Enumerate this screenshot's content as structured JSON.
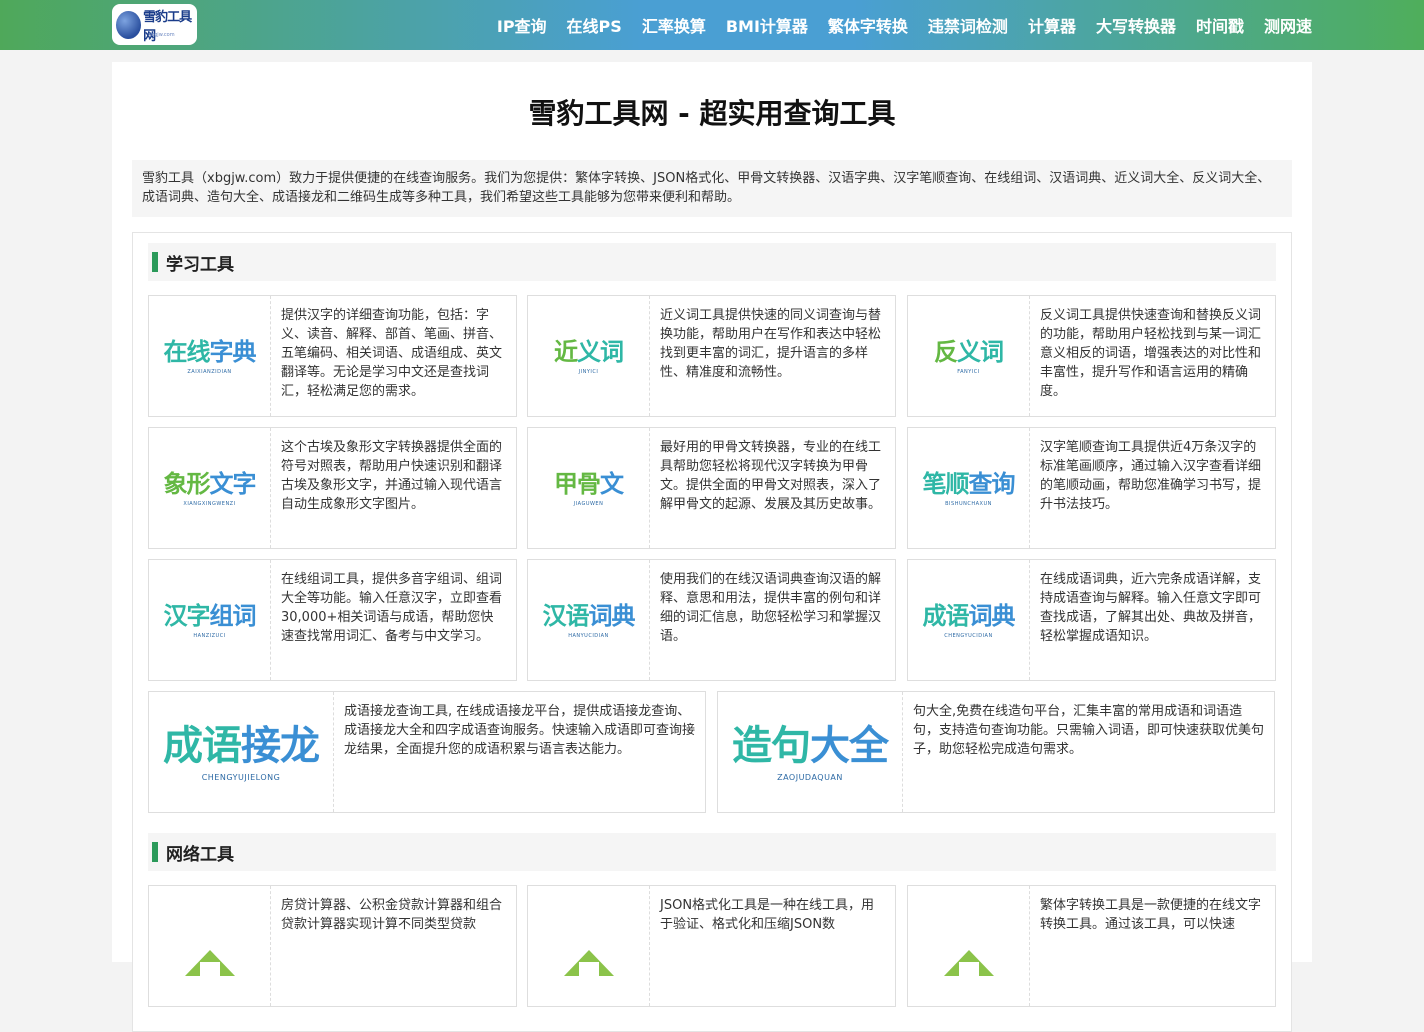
{
  "logo": {
    "text": "雪豹工具网",
    "sub": "xbgjw.com"
  },
  "nav": [
    "IP查询",
    "在线PS",
    "汇率换算",
    "BMI计算器",
    "繁体字转换",
    "违禁词检测",
    "计算器",
    "大写转换器",
    "时间戳",
    "测网速"
  ],
  "page_title": "雪豹工具网 - 超实用查询工具",
  "intro": "雪豹工具（xbgjw.com）致力于提供便捷的在线查询服务。我们为您提供：繁体字转换、JSON格式化、甲骨文转换器、汉语字典、汉字笔顺查询、在线组词、汉语词典、近义词大全、反义词大全、成语词典、造句大全、成语接龙和二维码生成等多种工具，我们希望这些工具能够为您带来便利和帮助。",
  "sections": {
    "study": {
      "title": "学习工具"
    },
    "network": {
      "title": "网络工具"
    }
  },
  "cards": [
    {
      "logo_a": "在线",
      "logo_b": "字典",
      "logo_sub": "ZAIXIANZIDIAN",
      "desc": "提供汉字的详细查询功能，包括：字义、读音、解释、部首、笔画、拼音、五笔编码、相关词语、成语组成、英文翻译等。无论是学习中文还是查找词汇，轻松满足您的需求。"
    },
    {
      "logo_a": "近",
      "logo_b": "义词",
      "logo_sub": "JINYICI",
      "desc": "近义词工具提供快速的同义词查询与替换功能，帮助用户在写作和表达中轻松找到更丰富的词汇，提升语言的多样性、精准度和流畅性。"
    },
    {
      "logo_a": "反",
      "logo_b": "义词",
      "logo_sub": "FANYICI",
      "desc": "反义词工具提供快速查询和替换反义词的功能，帮助用户轻松找到与某一词汇意义相反的词语，增强表达的对比性和丰富性，提升写作和语言运用的精确度。"
    },
    {
      "logo_a": "象形",
      "logo_b": "文字",
      "logo_sub": "XIANGXINGWENZI",
      "desc": "这个古埃及象形文字转换器提供全面的符号对照表，帮助用户快速识别和翻译古埃及象形文字，并通过输入现代语言自动生成象形文字图片。"
    },
    {
      "logo_a": "甲骨",
      "logo_b": "文",
      "logo_sub": "JIAGUWEN",
      "desc": "最好用的甲骨文转换器，专业的在线工具帮助您轻松将现代汉字转换为甲骨文。提供全面的甲骨文对照表，深入了解甲骨文的起源、发展及其历史故事。"
    },
    {
      "logo_a": "笔顺",
      "logo_b": "查询",
      "logo_sub": "BISHUNCHAXUN",
      "desc": "汉字笔顺查询工具提供近4万条汉字的标准笔画顺序，通过输入汉字查看详细的笔顺动画，帮助您准确学习书写，提升书法技巧。"
    },
    {
      "logo_a": "汉字",
      "logo_b": "组词",
      "logo_sub": "HANZIZUCI",
      "desc": "在线组词工具，提供多音字组词、组词大全等功能。输入任意汉字，立即查看30,000+相关词语与成语，帮助您快速查找常用词汇、备考与中文学习。"
    },
    {
      "logo_a": "汉语",
      "logo_b": "词典",
      "logo_sub": "HANYUCIDIAN",
      "desc": "使用我们的在线汉语词典查询汉语的解释、意思和用法，提供丰富的例句和详细的词汇信息，助您轻松学习和掌握汉语。"
    },
    {
      "logo_a": "成语",
      "logo_b": "词典",
      "logo_sub": "CHENGYUCIDIAN",
      "desc": "在线成语词典，近六完条成语详解，支持成语查询与解释。输入任意文字即可查找成语，了解其出处、典故及拼音，轻松掌握成语知识。"
    },
    {
      "logo_a": "成语",
      "logo_b": "接龙",
      "logo_sub": "CHENGYUJIELONG",
      "desc": "成语接龙查询工具, 在线成语接龙平台，提供成语接龙查询、成语接龙大全和四字成语查询服务。快速输入成语即可查询接龙结果，全面提升您的成语积累与语言表达能力。"
    },
    {
      "logo_a": "造句",
      "logo_b": "大全",
      "logo_sub": "ZAOJUDAQUAN",
      "desc": "句大全,免费在线造句平台，汇集丰富的常用成语和词语造句，支持造句查询功能。只需输入词语，即可快速获取优美句子，助您轻松完成造句需求。"
    }
  ],
  "net_cards": [
    {
      "desc": "房贷计算器、公积金贷款计算器和组合贷款计算器实现计算不同类型贷款"
    },
    {
      "desc": "JSON格式化工具是一种在线工具，用于验证、格式化和压缩JSON数"
    },
    {
      "desc": "繁体字转换工具是一款便捷的在线文字转换工具。通过该工具，可以快速"
    }
  ]
}
